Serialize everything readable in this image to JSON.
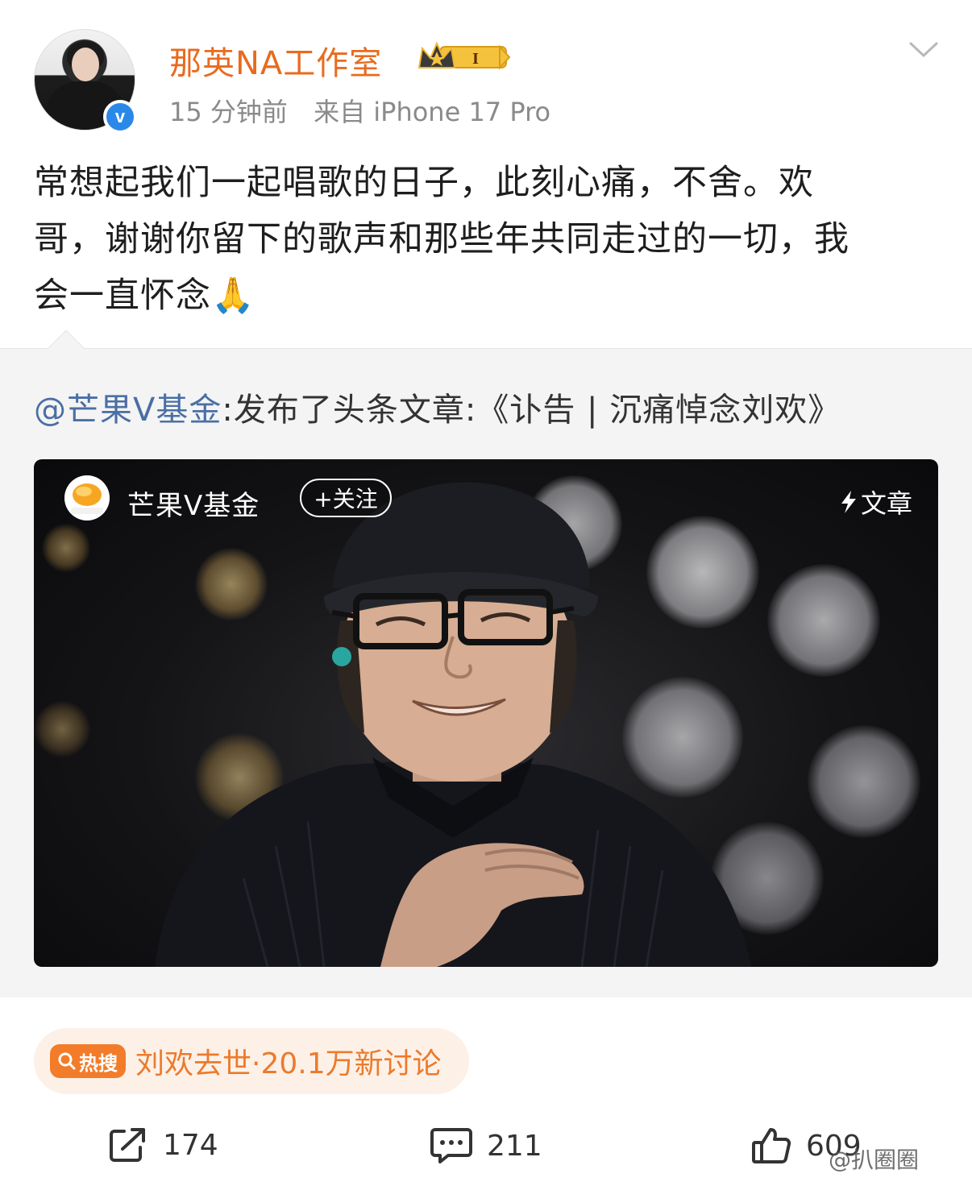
{
  "post": {
    "username": "那英NA工作室",
    "time": "15 分钟前",
    "source": "来自 iPhone 17 Pro",
    "text_line1": "常想起我们一起唱歌的日子，此刻心痛，不舍。欢",
    "text_line2": "哥，谢谢你留下的歌声和那些年共同走过的一切，我",
    "text_line3": "会一直怀念🙏",
    "member_level": "I"
  },
  "repost": {
    "mention": "@芒果V基金",
    "text": ":发布了头条文章:《讣告 | 沉痛悼念刘欢》"
  },
  "card": {
    "source_name": "芒果V基金",
    "follow_label": "+关注",
    "tag_label": "文章",
    "logo_text": "芒果V基金"
  },
  "hot_search": {
    "badge": "热搜",
    "text": "刘欢去世·20.1万新讨论"
  },
  "actions": {
    "repost_count": "174",
    "comment_count": "211",
    "like_count": "609"
  },
  "watermark": "@扒圈圈",
  "colors": {
    "username": "#e86b1f",
    "verified": "#2a89e8",
    "mention": "#4a6fa5",
    "hot_badge": "#f27c2a",
    "hot_text": "#ec7a2c"
  }
}
